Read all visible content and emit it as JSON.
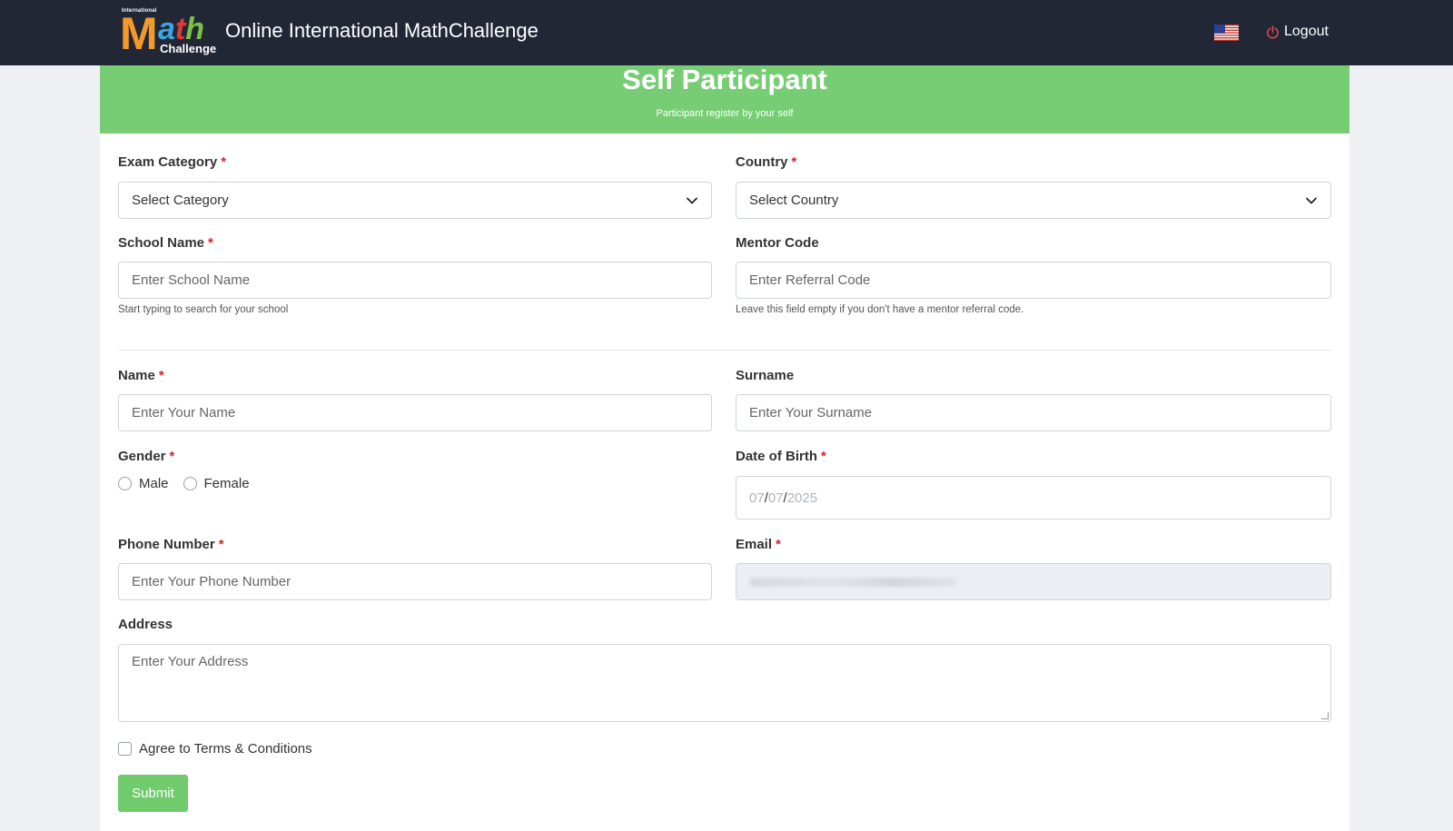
{
  "navbar": {
    "logo": {
      "top_text": "International",
      "letter_m": "M",
      "letter_a": "a",
      "letter_t": "t",
      "letter_h": "h",
      "bottom_text": "Challenge"
    },
    "title": "Online International MathChallenge",
    "language_flag_icon": "us-flag-icon",
    "logout_label": "Logout",
    "logout_icon": "power-icon"
  },
  "header": {
    "title": "Self Participant",
    "subtitle": "Participant register by your self"
  },
  "form": {
    "exam_category": {
      "label": "Exam Category",
      "required": "*",
      "value": "Select Category"
    },
    "country": {
      "label": "Country",
      "required": "*",
      "value": "Select Country"
    },
    "school_name": {
      "label": "School Name",
      "required": "*",
      "placeholder": "Enter School Name",
      "help": "Start typing to search for your school"
    },
    "mentor_code": {
      "label": "Mentor Code",
      "placeholder": "Enter Referral Code",
      "help": "Leave this field empty if you don't have a mentor referral code."
    },
    "name": {
      "label": "Name",
      "required": "*",
      "placeholder": "Enter Your Name"
    },
    "surname": {
      "label": "Surname",
      "placeholder": "Enter Your Surname"
    },
    "gender": {
      "label": "Gender",
      "required": "*",
      "options": [
        "Male",
        "Female"
      ]
    },
    "dob": {
      "label": "Date of Birth",
      "required": "*",
      "month": "07",
      "day": "07",
      "year": "2025",
      "sep": "/"
    },
    "phone": {
      "label": "Phone Number",
      "required": "*",
      "placeholder": "Enter Your Phone Number"
    },
    "email": {
      "label": "Email",
      "required": "*"
    },
    "address": {
      "label": "Address",
      "placeholder": "Enter Your Address"
    },
    "terms_label": "Agree to Terms & Conditions",
    "submit_label": "Submit"
  },
  "colors": {
    "navbar": "#222736",
    "header_green": "#76cd73",
    "submit_green": "#6fcb6c",
    "required_red": "#d9202e"
  }
}
